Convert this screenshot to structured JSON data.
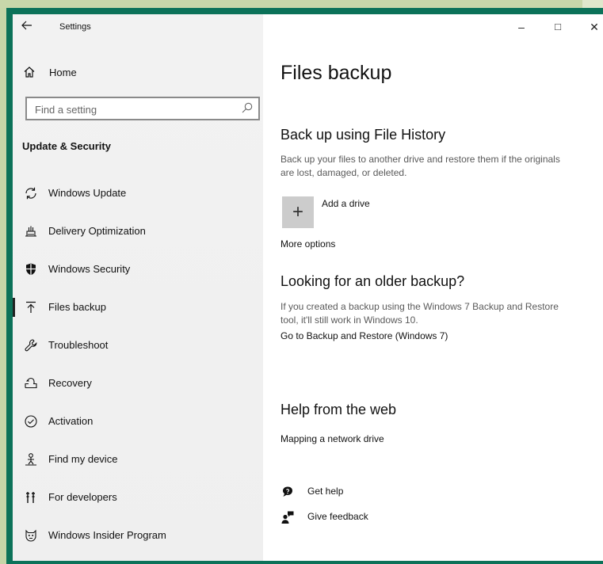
{
  "window": {
    "title": "Settings",
    "controls": {
      "minimize": "–",
      "maximize": "□",
      "close": "✕"
    }
  },
  "sidebar": {
    "home_label": "Home",
    "search_placeholder": "Find a setting",
    "section_title": "Update & Security",
    "items": [
      {
        "label": "Windows Update",
        "icon": "sync-icon"
      },
      {
        "label": "Delivery Optimization",
        "icon": "delivery-optimization-icon"
      },
      {
        "label": "Windows Security",
        "icon": "shield-icon"
      },
      {
        "label": "Files backup",
        "icon": "backup-arrow-icon",
        "active": true
      },
      {
        "label": "Troubleshoot",
        "icon": "wrench-icon"
      },
      {
        "label": "Recovery",
        "icon": "recovery-icon"
      },
      {
        "label": "Activation",
        "icon": "check-circle-icon"
      },
      {
        "label": "Find my device",
        "icon": "person-location-icon"
      },
      {
        "label": "For developers",
        "icon": "developer-tools-icon"
      },
      {
        "label": "Windows Insider Program",
        "icon": "insider-cat-icon"
      }
    ]
  },
  "main": {
    "page_title": "Files backup",
    "file_history": {
      "heading": "Back up using File History",
      "description": "Back up your files to another drive and restore them if the originals are lost, damaged, or deleted.",
      "add_drive_label": "Add a drive",
      "more_options": "More options"
    },
    "older_backup": {
      "heading": "Looking for an older backup?",
      "description": "If you created a backup using the Windows 7 Backup and Restore tool, it'll still work in Windows 10.",
      "link": "Go to Backup and Restore (Windows 7)"
    },
    "help": {
      "heading": "Help from the web",
      "link": "Mapping a network drive"
    },
    "footer": {
      "get_help": "Get help",
      "give_feedback": "Give feedback"
    }
  },
  "colors": {
    "frame": "#0c7259",
    "desktop": "#c6d6a8",
    "sidebar_bg": "#f2f2f2",
    "add_button": "#cccccc"
  }
}
